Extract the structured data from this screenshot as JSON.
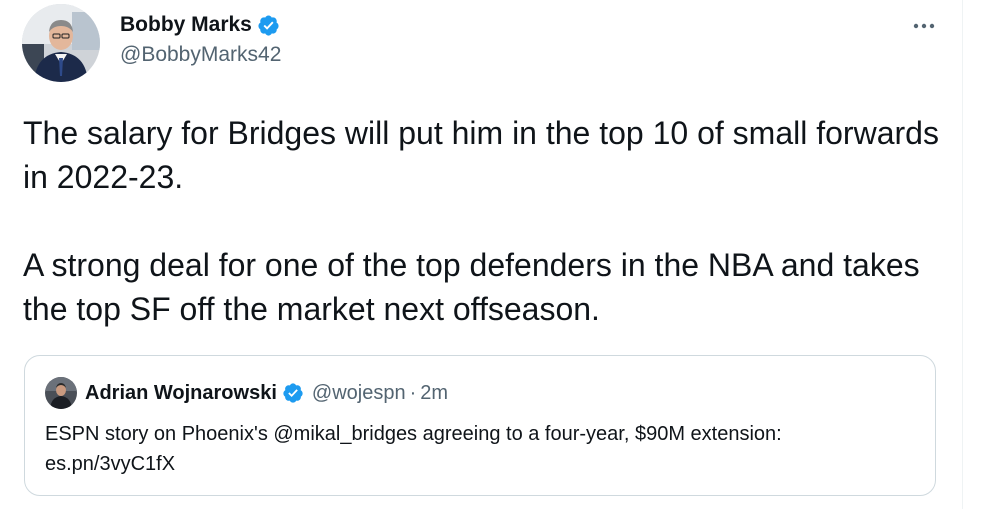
{
  "tweet": {
    "author": {
      "display_name": "Bobby Marks",
      "handle": "@BobbyMarks42",
      "verified": true
    },
    "text": "The salary for Bridges will put him in the top 10 of small forwards in 2022-23.\n\nA strong deal for one of the top defenders in the NBA and takes the top SF off the market next offseason.",
    "more_icon": "more-horizontal-icon"
  },
  "quote": {
    "author": {
      "display_name": "Adrian Wojnarowski",
      "handle": "@wojespn",
      "separator": "·",
      "time": "2m",
      "verified": true
    },
    "text": "ESPN story on Phoenix's @mikal_bridges agreeing to a four-year, $90M extension: es.pn/3vyC1fX"
  },
  "colors": {
    "verified_blue": "#1d9bf0",
    "secondary_text": "#536471",
    "border": "#cfd9de"
  }
}
